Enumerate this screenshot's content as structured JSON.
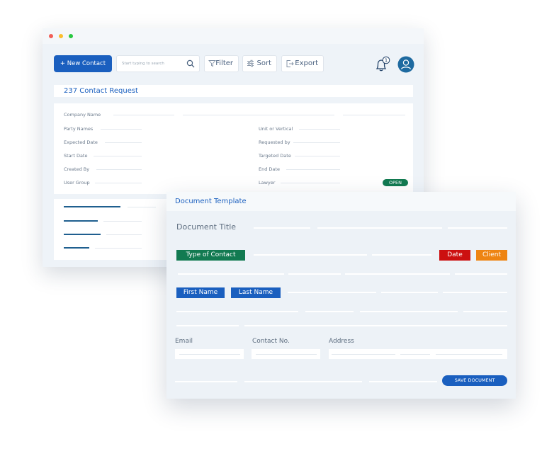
{
  "window": {
    "traffic_lights": {
      "close": "#f25f58",
      "minimize": "#fbbe2e",
      "zoom": "#28c840"
    }
  },
  "toolbar": {
    "new_contact_label": "+ New Contact",
    "search_placeholder": "Start typing to search",
    "filter_label": "Filter",
    "sort_label": "Sort",
    "export_label": "Export",
    "notification_count": "1",
    "accent_color": "#1a5fbf"
  },
  "request": {
    "title": "237 Contact Request"
  },
  "details": {
    "company_name_label": "Company Name",
    "left_fields": [
      "Party Names",
      "Expected Date",
      "Start Date",
      "Created By",
      "User Group"
    ],
    "right_fields": [
      "Unit or Vertical",
      "Requested by",
      "Targeted Date",
      "End Date",
      "Lawyer"
    ],
    "status": "OPEN",
    "status_color": "#127a51"
  },
  "document": {
    "header_title": "Document Template",
    "document_title_label": "Document Title",
    "type_of_contact": "Type of Contact",
    "date_tag": "Date",
    "client_tag": "Client",
    "first_name": "First Name",
    "last_name": "Last Name",
    "email_label": "Email",
    "contact_no_label": "Contact No.",
    "address_label": "Address",
    "save_button": "SAVE DOCUMENT",
    "colors": {
      "green": "#127a51",
      "red": "#cc1010",
      "orange": "#ee8412",
      "blue": "#1a5fbf"
    }
  }
}
